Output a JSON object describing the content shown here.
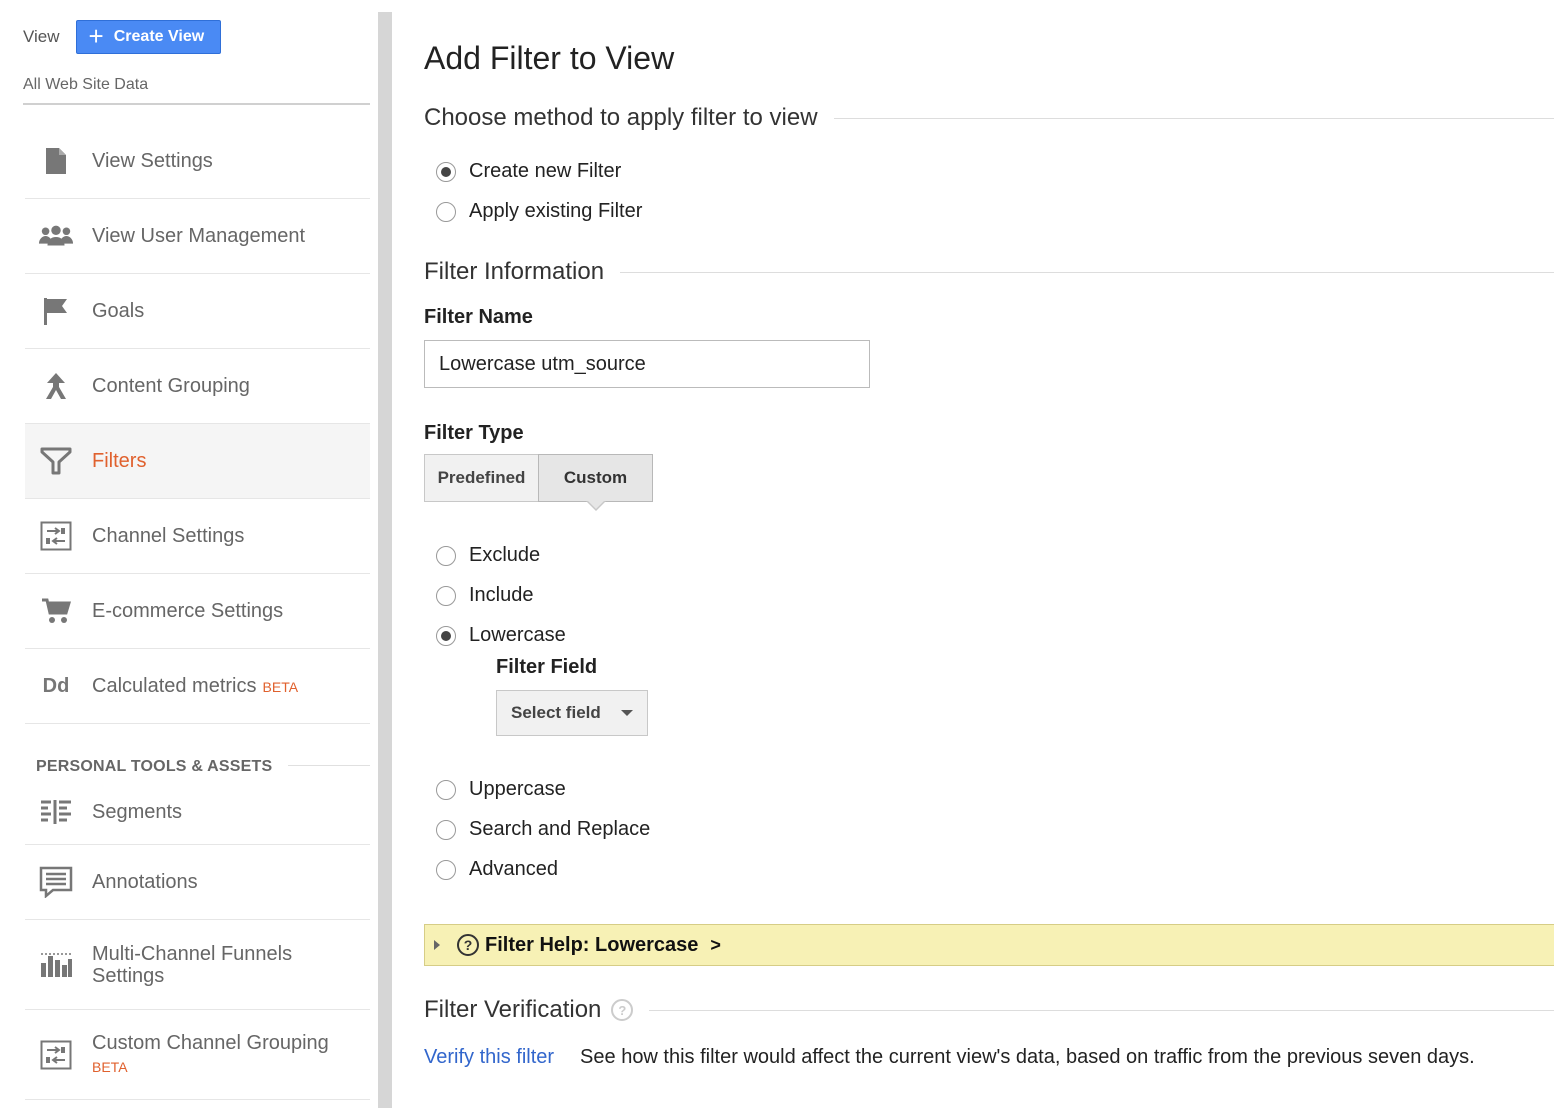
{
  "sidebar": {
    "view_label": "View",
    "create_view_label": "Create View",
    "view_name": "All Web Site Data",
    "items": [
      {
        "label": "View Settings",
        "icon": "document-icon"
      },
      {
        "label": "View User Management",
        "icon": "users-icon"
      },
      {
        "label": "Goals",
        "icon": "flag-icon"
      },
      {
        "label": "Content Grouping",
        "icon": "content-grouping-icon"
      },
      {
        "label": "Filters",
        "icon": "filter-icon",
        "active": true
      },
      {
        "label": "Channel Settings",
        "icon": "channel-settings-icon"
      },
      {
        "label": "E-commerce Settings",
        "icon": "cart-icon"
      },
      {
        "label": "Calculated metrics",
        "icon": "dd-icon",
        "badge": "BETA"
      }
    ],
    "personal_section_title": "PERSONAL TOOLS & ASSETS",
    "personal_items": [
      {
        "label": "Segments",
        "icon": "segments-icon"
      },
      {
        "label": "Annotations",
        "icon": "annotations-icon"
      },
      {
        "label": "Multi-Channel Funnels Settings",
        "icon": "bar-chart-icon"
      },
      {
        "label": "Custom Channel Grouping",
        "icon": "channel-settings-icon",
        "badge": "BETA"
      }
    ],
    "icon_dd_text": "Dd"
  },
  "main": {
    "title": "Add Filter to View",
    "method_section": "Choose method to apply filter to view",
    "method_options": [
      {
        "label": "Create new Filter",
        "checked": true
      },
      {
        "label": "Apply existing Filter",
        "checked": false
      }
    ],
    "info_section": "Filter Information",
    "filter_name_label": "Filter Name",
    "filter_name_value": "Lowercase utm_source",
    "filter_type_label": "Filter Type",
    "filter_type_tabs": [
      "Predefined",
      "Custom"
    ],
    "filter_type_selected": "Custom",
    "custom_options": [
      {
        "label": "Exclude",
        "checked": false
      },
      {
        "label": "Include",
        "checked": false
      },
      {
        "label": "Lowercase",
        "checked": true
      },
      {
        "label": "Uppercase",
        "checked": false
      },
      {
        "label": "Search and Replace",
        "checked": false
      },
      {
        "label": "Advanced",
        "checked": false
      }
    ],
    "filter_field_label": "Filter Field",
    "select_field_label": "Select field",
    "help_text": "Filter Help: Lowercase",
    "help_chevron": ">",
    "help_q": "?",
    "verification_section": "Filter Verification",
    "verify_link": "Verify this filter",
    "verify_description": "See how this filter would affect the current view's data, based on traffic from the previous seven days."
  },
  "colors": {
    "accent_blue": "#4a8af4",
    "active_orange": "#e0612e",
    "help_yellow": "#f7f1b5",
    "link_blue": "#3266cc"
  }
}
